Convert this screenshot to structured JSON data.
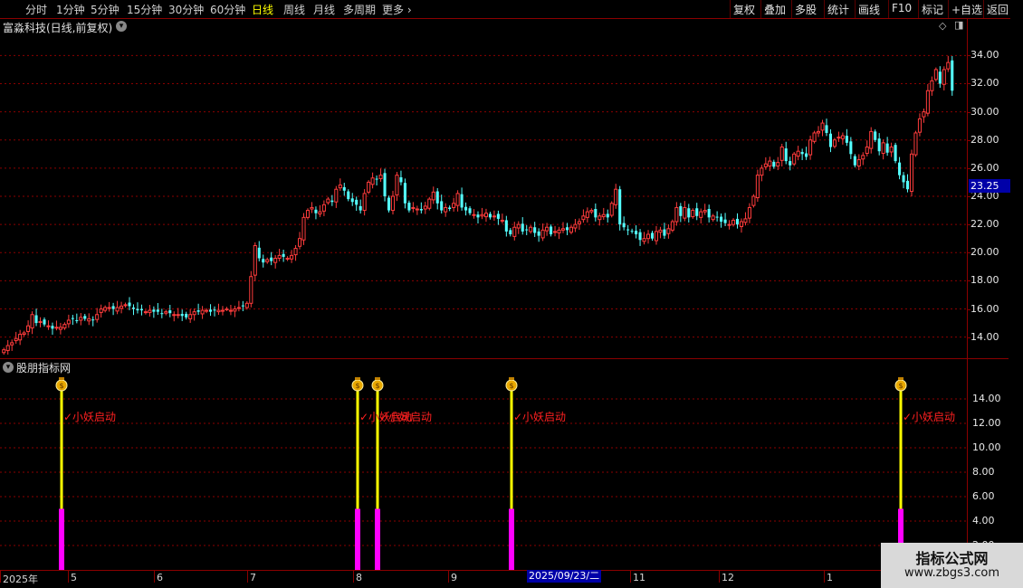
{
  "toolbar": {
    "periods": [
      "分时",
      "1分钟",
      "5分钟",
      "15分钟",
      "30分钟",
      "60分钟",
      "日线",
      "周线",
      "月线",
      "多周期",
      "更多"
    ],
    "active_period": "日线",
    "right_buttons": [
      "复权",
      "叠加",
      "多股",
      "统计",
      "画线",
      "F10",
      "标记",
      "+自选",
      "返回"
    ]
  },
  "chart_title": "富淼科技(日线,前复权)",
  "indicator_title": "股朋指标网",
  "price_tag": "23.25",
  "x_date_highlight": "2025/09/23/二",
  "signal_label": "小妖启动",
  "watermark": {
    "line1": "指标公式网",
    "line2": "www.zbgs3.com"
  },
  "colors": {
    "up": "#ff3c3c",
    "down": "#54ffff",
    "signal_line": "#ffff00",
    "signal_bar": "#ff00ff",
    "grid": "#8b0000"
  },
  "chart_data": [
    {
      "type": "candlestick",
      "title": "富淼科技(日线,前复权)",
      "y_ticks": [
        "34.00",
        "32.00",
        "30.00",
        "28.00",
        "26.00",
        "24.00",
        "22.00",
        "20.00",
        "18.00",
        "16.00",
        "14.00"
      ],
      "ylim": [
        12.5,
        35.5
      ],
      "x_ticks": [
        "2025年",
        "5",
        "6",
        "7",
        "8",
        "9",
        "11",
        "12",
        "1"
      ],
      "closes": [
        13.1,
        13.4,
        13.6,
        13.9,
        14.2,
        14.3,
        14.8,
        15.6,
        15.0,
        15.1,
        14.9,
        14.8,
        14.6,
        14.7,
        14.7,
        14.9,
        15.2,
        15.3,
        15.2,
        15.4,
        15.3,
        15.3,
        15.2,
        15.6,
        16.0,
        16.1,
        16.1,
        16.0,
        16.1,
        16.2,
        16.3,
        16.2,
        16.0,
        15.9,
        15.9,
        15.8,
        15.9,
        15.8,
        15.8,
        15.7,
        15.8,
        15.7,
        15.6,
        15.6,
        15.5,
        15.4,
        15.6,
        15.8,
        15.8,
        15.9,
        15.9,
        15.8,
        15.9,
        15.9,
        15.9,
        16.0,
        15.9,
        16.0,
        16.1,
        16.2,
        16.4,
        18.3,
        20.5,
        19.6,
        19.3,
        19.5,
        19.4,
        19.6,
        19.8,
        19.7,
        19.6,
        19.8,
        20.3,
        21.0,
        22.5,
        23.0,
        23.2,
        22.8,
        22.9,
        23.4,
        23.8,
        23.6,
        24.5,
        24.8,
        24.4,
        23.8,
        23.6,
        23.4,
        23.0,
        24.2,
        25.0,
        25.3,
        25.2,
        25.5,
        24.0,
        23.0,
        24.0,
        25.5,
        25.0,
        23.5,
        23.0,
        23.2,
        23.1,
        23.0,
        23.3,
        23.8,
        24.3,
        23.5,
        23.0,
        23.2,
        23.1,
        23.5,
        24.2,
        23.2,
        23.0,
        22.8,
        22.7,
        22.5,
        22.7,
        22.8,
        22.5,
        22.6,
        22.4,
        22.3,
        21.5,
        21.3,
        21.8,
        22.0,
        21.5,
        21.6,
        21.8,
        21.4,
        21.2,
        21.6,
        21.8,
        21.3,
        21.5,
        21.6,
        21.7,
        21.6,
        21.8,
        22.0,
        22.2,
        22.6,
        22.9,
        23.0,
        22.5,
        22.6,
        22.7,
        22.5,
        23.5,
        24.5,
        22.0,
        21.8,
        21.6,
        21.5,
        21.3,
        20.9,
        21.0,
        21.3,
        21.0,
        21.5,
        21.6,
        21.2,
        21.7,
        22.2,
        23.2,
        22.6,
        23.2,
        22.5,
        23.0,
        22.6,
        22.9,
        23.0,
        22.5,
        22.6,
        22.5,
        22.2,
        22.1,
        22.0,
        22.3,
        22.0,
        22.2,
        22.4,
        23.2,
        24.0,
        25.5,
        26.0,
        26.3,
        26.5,
        26.1,
        26.4,
        27.5,
        26.5,
        26.2,
        27.0,
        27.2,
        27.0,
        26.8,
        28.0,
        28.5,
        28.6,
        29.2,
        28.5,
        27.5,
        28.0,
        28.2,
        28.3,
        27.8,
        27.0,
        26.2,
        26.6,
        26.9,
        27.5,
        28.6,
        28.0,
        27.2,
        27.8,
        27.1,
        27.5,
        26.5,
        25.5,
        25.0,
        24.5,
        27.0,
        28.5,
        29.5,
        30.0,
        31.5,
        32.2,
        33.0,
        32.0,
        33.0,
        33.5,
        31.5
      ]
    },
    {
      "type": "bar",
      "title": "股朋指标网",
      "y_ticks": [
        "14.00",
        "12.00",
        "10.00",
        "8.00",
        "6.00",
        "4.00",
        "2.00"
      ],
      "ylim": [
        0,
        16
      ],
      "signal_bars": [
        8,
        81,
        86,
        119,
        215,
        248
      ],
      "signal_value": 15,
      "signal_base": 5
    }
  ]
}
